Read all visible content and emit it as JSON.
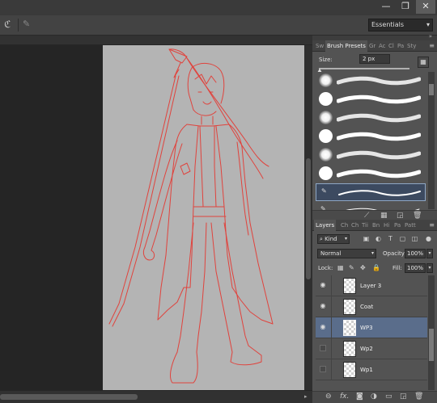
{
  "window": {
    "minimize_glyph": "—",
    "restore_glyph": "❐",
    "close_glyph": "✕"
  },
  "options_bar": {
    "workspace": "Essentials"
  },
  "brush_panel": {
    "tabs": [
      "Sw",
      "Brush Presets",
      "Gr",
      "Ac",
      "Cl",
      "Pa",
      "Sty"
    ],
    "size_label": "Size:",
    "size_value": "2 px",
    "presets": [
      {
        "kind": "soft"
      },
      {
        "kind": "hard"
      },
      {
        "kind": "soft"
      },
      {
        "kind": "hard"
      },
      {
        "kind": "soft"
      },
      {
        "kind": "hard"
      },
      {
        "kind": "selected"
      },
      {
        "kind": "partial"
      }
    ]
  },
  "layers_panel": {
    "tabs": [
      "Layers",
      "Ch",
      "Ch",
      "Tii",
      "Bn",
      "Hi",
      "Pa",
      "Patt"
    ],
    "kind_label": "Kind",
    "blend_mode": "Normal",
    "opacity_label": "Opacity:",
    "opacity_value": "100%",
    "lock_label": "Lock:",
    "fill_label": "Fill:",
    "fill_value": "100%",
    "layers": [
      {
        "name": "Layer 3",
        "visible": true,
        "selected": false
      },
      {
        "name": "Coat",
        "visible": true,
        "selected": false
      },
      {
        "name": "WP3",
        "visible": true,
        "selected": true
      },
      {
        "name": "Wp2",
        "visible": false,
        "selected": false
      },
      {
        "name": "Wp1",
        "visible": false,
        "selected": false
      }
    ],
    "footer_fx": "fx."
  },
  "colors": {
    "line_art": "#e0433d",
    "canvas_bg": "#b4b4b4",
    "selection": "#5a6d8b"
  }
}
